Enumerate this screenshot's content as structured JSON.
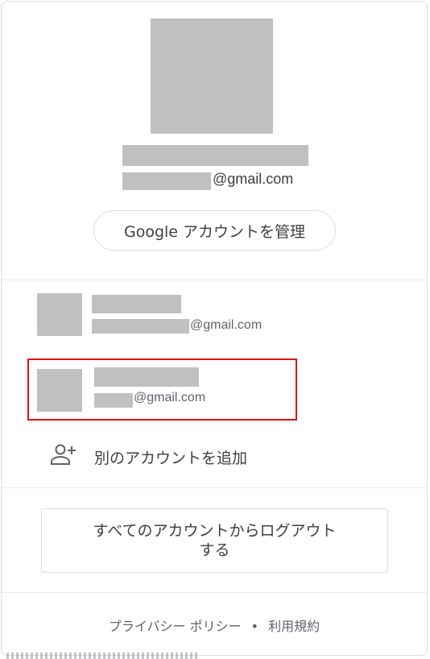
{
  "profile": {
    "email_suffix": "@gmail.com",
    "manage_button_label": "Google アカウントを管理"
  },
  "accounts": [
    {
      "email_suffix": "@gmail.com"
    },
    {
      "email_suffix": "@gmail.com",
      "highlighted": true
    }
  ],
  "add_account": {
    "label": "別のアカウントを追加",
    "icon": "person-add-icon"
  },
  "logout": {
    "label": "すべてのアカウントからログアウトする"
  },
  "footer": {
    "privacy": "プライバシー ポリシー",
    "separator": "•",
    "terms": "利用規約"
  },
  "colors": {
    "highlight": "#e0100f",
    "redaction": "#c0c0c0",
    "border": "#dadce0"
  }
}
